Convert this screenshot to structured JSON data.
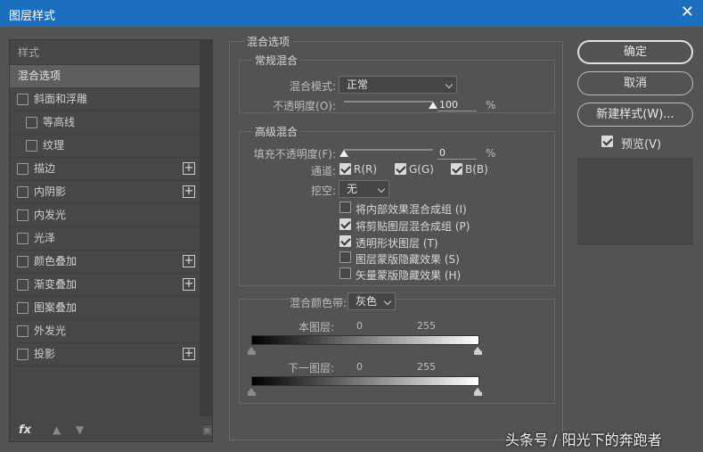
{
  "window": {
    "title": "图层样式",
    "close_glyph": "✕"
  },
  "sidebar": {
    "header": "样式",
    "items": [
      {
        "label": "混合选项",
        "selected": true
      },
      {
        "label": "斜面和浮雕",
        "checkbox": true,
        "checked": false
      },
      {
        "label": "等高线",
        "checkbox": true,
        "checked": false,
        "sub": true
      },
      {
        "label": "纹理",
        "checkbox": true,
        "checked": false,
        "sub": true
      },
      {
        "label": "描边",
        "checkbox": true,
        "checked": false,
        "plus": true
      },
      {
        "label": "内阴影",
        "checkbox": true,
        "checked": false,
        "plus": true
      },
      {
        "label": "内发光",
        "checkbox": true,
        "checked": false
      },
      {
        "label": "光泽",
        "checkbox": true,
        "checked": false
      },
      {
        "label": "颜色叠加",
        "checkbox": true,
        "checked": false,
        "plus": true
      },
      {
        "label": "渐变叠加",
        "checkbox": true,
        "checked": false,
        "plus": true
      },
      {
        "label": "图案叠加",
        "checkbox": true,
        "checked": false
      },
      {
        "label": "外发光",
        "checkbox": true,
        "checked": false
      },
      {
        "label": "投影",
        "checkbox": true,
        "checked": false,
        "plus": true
      }
    ],
    "footer": {
      "fx": "fx",
      "up_icon": "arrow-up-icon",
      "down_icon": "arrow-down-icon",
      "trash_icon": "trash-icon"
    }
  },
  "main": {
    "section_title": "混合选项",
    "general": {
      "title": "常规混合",
      "blend_mode_label": "混合模式:",
      "blend_mode_value": "正常",
      "opacity_label": "不透明度(O):",
      "opacity_value": "100",
      "opacity_unit": "%",
      "opacity_fraction": 1.0
    },
    "advanced": {
      "title": "高级混合",
      "fill_opacity_label": "填充不透明度(F):",
      "fill_opacity_value": "0",
      "fill_opacity_unit": "%",
      "fill_opacity_fraction": 0.0,
      "channels_label": "通道:",
      "channels": [
        {
          "label": "R(R)",
          "checked": true
        },
        {
          "label": "G(G)",
          "checked": true
        },
        {
          "label": "B(B)",
          "checked": true
        }
      ],
      "knockout_label": "挖空:",
      "knockout_value": "无",
      "options": [
        {
          "label": "将内部效果混合成组 (I)",
          "checked": false
        },
        {
          "label": "将剪贴图层混合成组 (P)",
          "checked": true
        },
        {
          "label": "透明形状图层 (T)",
          "checked": true
        },
        {
          "label": "图层蒙版隐藏效果 (S)",
          "checked": false
        },
        {
          "label": "矢量蒙版隐藏效果 (H)",
          "checked": false
        }
      ]
    },
    "blend_if": {
      "label": "混合颜色带:",
      "value": "灰色",
      "this_layer_label": "本图层:",
      "this_layer_min": "0",
      "this_layer_max": "255",
      "underlying_label": "下一图层:",
      "underlying_min": "0",
      "underlying_max": "255"
    }
  },
  "actions": {
    "ok": "确定",
    "cancel": "取消",
    "new_style": "新建样式(W)...",
    "preview_label": "预览(V)",
    "preview_checked": true
  },
  "watermark": "头条号 / 阳光下的奔跑者"
}
